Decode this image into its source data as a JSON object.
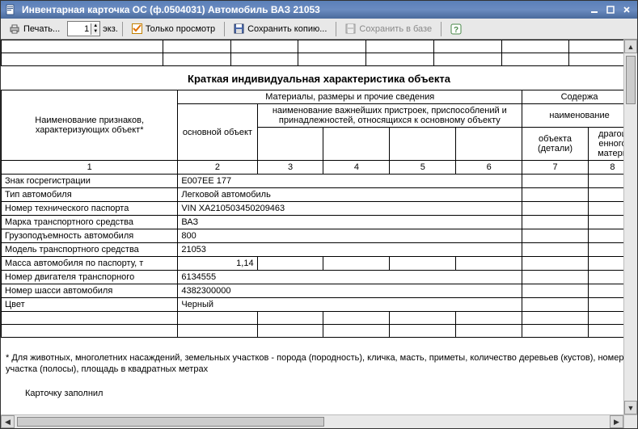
{
  "window": {
    "title": "Инвентарная карточка ОС (ф.0504031) Автомобиль ВАЗ 21053"
  },
  "toolbar": {
    "print_label": "Печать...",
    "copies_value": "1",
    "copies_unit": "экз.",
    "preview_only": "Только просмотр",
    "save_copy": "Сохранить копию...",
    "save_db": "Сохранить в базе"
  },
  "section": {
    "title": "Краткая индивидуальная характеристика объекта"
  },
  "headers": {
    "col1": "Наименование признаков, характеризующих объект*",
    "main_obj": "основной объект",
    "materials": "Материалы, размеры и прочие сведения",
    "attachments": "наименование важнейших пристроек, приспособлений и принадлежностей, относящихся к основному объекту",
    "soderzh": "Содержа",
    "naimenov": "наимeнование",
    "obj_detail": "объекта (детали)",
    "drag": "драгоц енного матери",
    "c1": "1",
    "c2": "2",
    "c3": "3",
    "c4": "4",
    "c5": "5",
    "c6": "6",
    "c7": "7",
    "c8": "8"
  },
  "rows": [
    {
      "label": "Знак госрегистрации",
      "value": "Е007ЕЕ 177"
    },
    {
      "label": "Тип автомобиля",
      "value": "Легковой автомобиль"
    },
    {
      "label": "Номер технического паспорта",
      "value": "VIN XA210503450209463"
    },
    {
      "label": "Марка транспортного средства",
      "value": "ВАЗ"
    },
    {
      "label": "Грузоподъемность автомобиля",
      "value": "800"
    },
    {
      "label": "Модель транспортного средства",
      "value": "21053"
    },
    {
      "label": "Масса автомобиля по паспорту, т",
      "value": "1,14",
      "numeric": true
    },
    {
      "label": "Номер двигателя транспорного",
      "value": "6134555"
    },
    {
      "label": "Номер шасси автомобиля",
      "value": "4382300000"
    },
    {
      "label": "Цвет",
      "value": "Черный"
    }
  ],
  "footnote": "* Для животных, многолетних насаждений, земельных участков - порода (породность), кличка, масть, приметы, количество деревьев (кустов), номер участка (полосы), площадь в квадратных метрах",
  "sign": {
    "label": "Карточку заполнил"
  }
}
